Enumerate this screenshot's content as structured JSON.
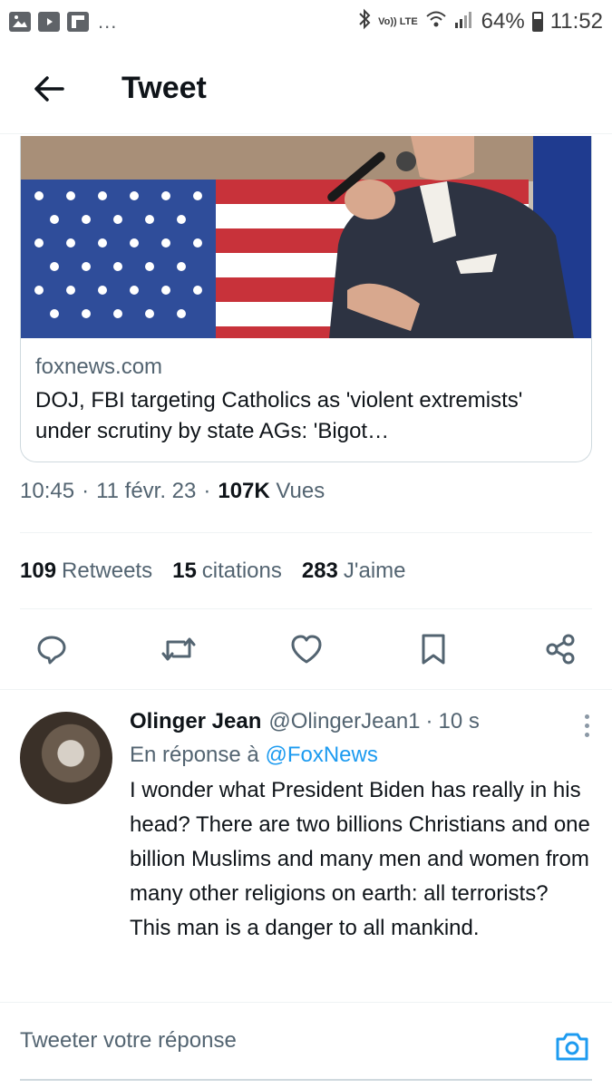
{
  "status_bar": {
    "network_label": "Vo)) LTE",
    "battery": "64%",
    "time": "11:52",
    "more": "..."
  },
  "header": {
    "title": "Tweet"
  },
  "card": {
    "domain": "foxnews.com",
    "title": "DOJ, FBI targeting Catholics as 'violent extremists' under scrutiny by state AGs: 'Bigot…"
  },
  "meta": {
    "time": "10:45",
    "date": "11 févr. 23",
    "views_count": "107K",
    "views_label": "Vues"
  },
  "stats": {
    "retweets_count": "109",
    "retweets_label": "Retweets",
    "quotes_count": "15",
    "quotes_label": "citations",
    "likes_count": "283",
    "likes_label": "J'aime"
  },
  "reply": {
    "name": "Olinger Jean",
    "handle": "@OlingerJean1",
    "time": "10 s",
    "reply_to_prefix": "En réponse à",
    "reply_to_mention": "@FoxNews",
    "text": "I wonder what President Biden has really in his head? There are two billions Christians and one billion Muslims and many men and women from many other religions on earth: all terrorists? This man is a danger to all mankind."
  },
  "compose": {
    "placeholder": "Tweeter votre réponse"
  },
  "colors": {
    "accent": "#1d9bf0",
    "secondary_text": "#536471",
    "primary_text": "#0f1419"
  }
}
